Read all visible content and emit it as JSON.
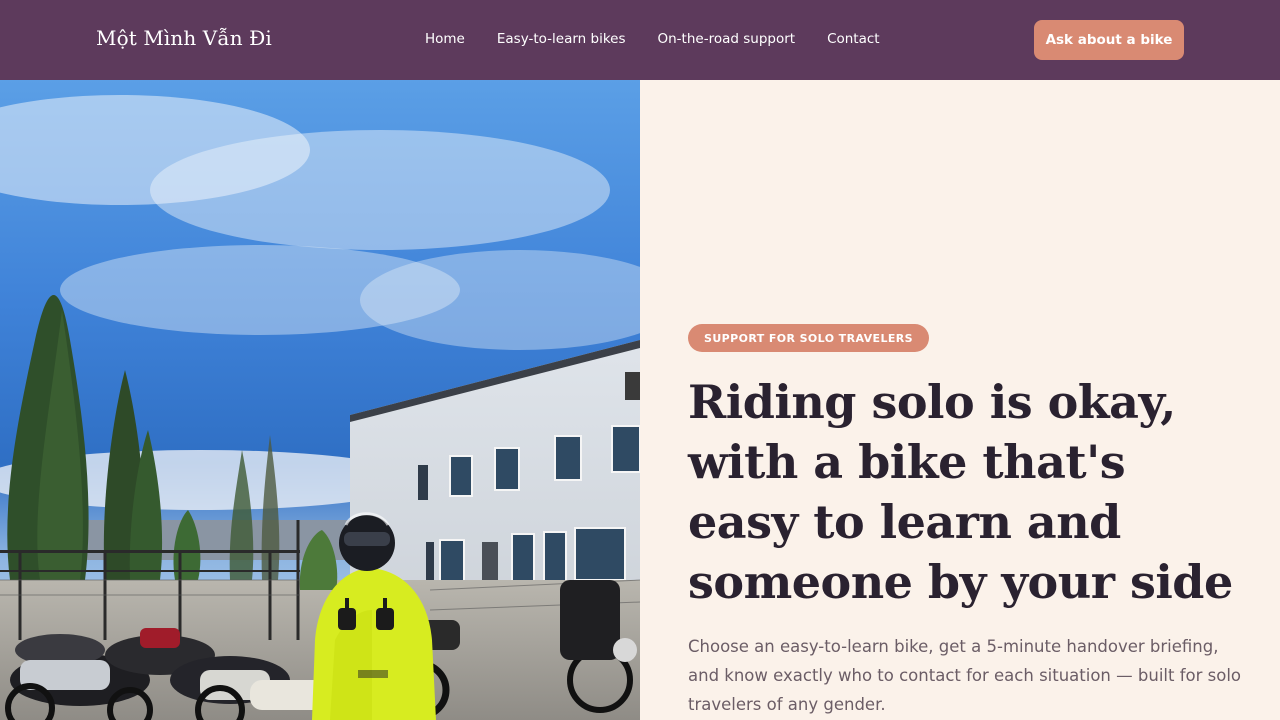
{
  "header": {
    "brand": "Một Mình Vẫn Đi",
    "nav": [
      "Home",
      "Easy-to-learn bikes",
      "On-the-road support",
      "Contact"
    ],
    "cta_label": "Ask about a bike"
  },
  "hero": {
    "badge": "SUPPORT FOR SOLO TRAVELERS",
    "headline": "Riding solo is okay, with a bike that's easy to learn and someone by your side",
    "body": "Choose an easy-to-learn bike, get a 5-minute handover briefing, and know exactly who to contact for each situation — built for solo travelers of any gender.",
    "image_subject": "rider in a yellow jacket and helmet giving thumbs up beside parked motorcycles in front of a white building"
  },
  "colors": {
    "header_bg": "#5d3a5c",
    "accent": "#d98a73",
    "page_bg": "#fbf2ea",
    "headline": "#2a2230",
    "body_text": "#6b5d66"
  }
}
